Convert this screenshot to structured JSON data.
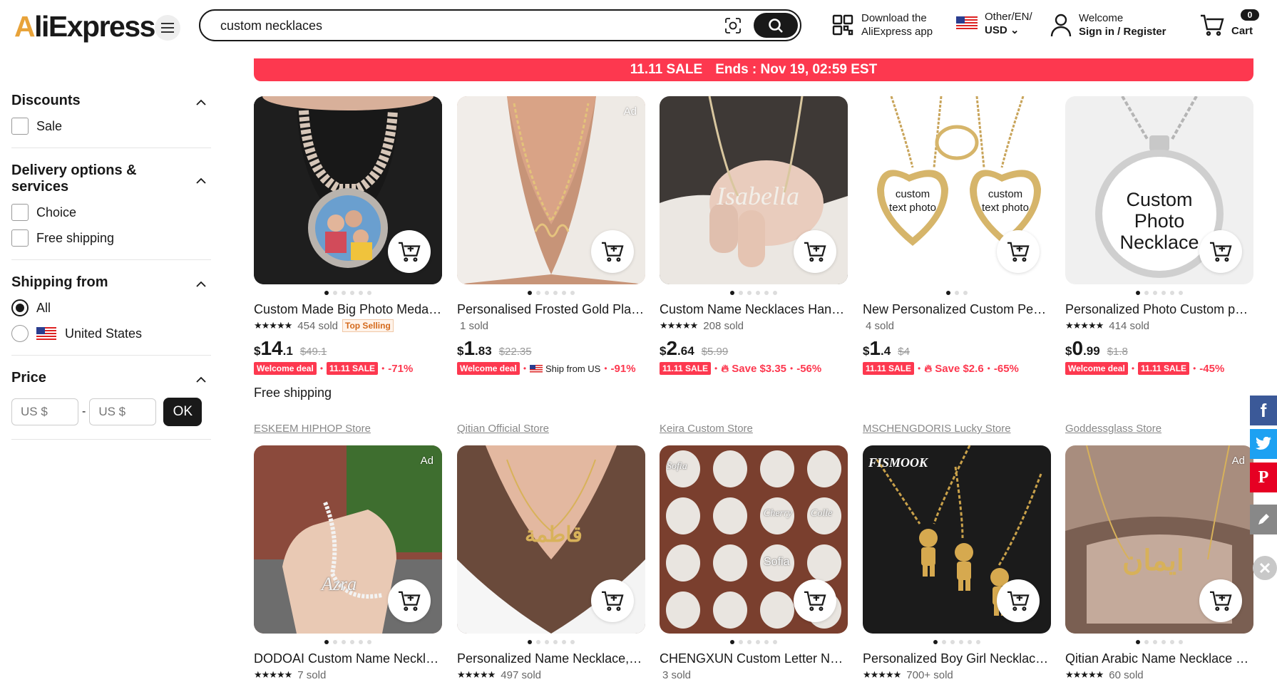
{
  "header": {
    "logo_text": "AliExpress",
    "search_value": "custom necklaces",
    "app_line1": "Download the",
    "app_line2": "AliExpress app",
    "region_line1": "Other/EN/",
    "region_line2": "USD",
    "account_line1": "Welcome",
    "account_line2": "Sign in / Register",
    "cart_count": "0",
    "cart_label": "Cart"
  },
  "banner": {
    "sale": "11.11 SALE",
    "ends": "Ends :  Nov 19, 02:59 EST"
  },
  "sidebar": {
    "discounts": {
      "title": "Discounts",
      "options": [
        "Sale"
      ]
    },
    "delivery": {
      "title": "Delivery options & services",
      "options": [
        "Choice",
        "Free shipping"
      ]
    },
    "shipping": {
      "title": "Shipping from",
      "options": [
        "All",
        "United States"
      ]
    },
    "price": {
      "title": "Price",
      "min_placeholder": "US $",
      "max_placeholder": "US $",
      "dash": "-",
      "ok": "OK"
    }
  },
  "products": [
    {
      "title": "Custom Made Big Photo Medallions Necklace",
      "sold": "454 sold",
      "top_selling": "Top Selling",
      "cur": "$",
      "int": "14",
      "dec": ".1",
      "old": "$49.1",
      "tag1": "Welcome deal",
      "tag2": "11.11 SALE",
      "discount": "-71%",
      "free": "Free shipping",
      "store": "ESKEEM HIPHOP Store",
      "ad": ""
    },
    {
      "title": "Personalised Frosted Gold Plated Name Necklace",
      "sold": "1 sold",
      "cur": "$",
      "int": "1",
      "dec": ".83",
      "old": "$22.35",
      "tag1": "Welcome deal",
      "ship": "Ship from US",
      "discount": "-91%",
      "store": "Qitian Official Store",
      "ad": "Ad"
    },
    {
      "title": "Custom Name Necklaces Handmade",
      "sold": "208 sold",
      "cur": "$",
      "int": "2",
      "dec": ".64",
      "old": "$5.99",
      "tag1": "11.11 SALE",
      "save": "Save $3.35",
      "discount": "-56%",
      "store": "Keira Custom Store",
      "ad": ""
    },
    {
      "title": "New Personalized Custom Pendant",
      "sold": "4 sold",
      "cur": "$",
      "int": "1",
      "dec": ".4",
      "old": "$4",
      "tag1": "11.11 SALE",
      "save": "Save $2.6",
      "discount": "-65%",
      "store": "MSCHENGDORIS Lucky Store",
      "ad": "",
      "photo_text1": "custom text photo",
      "photo_text2": "custom text photo"
    },
    {
      "title": "Personalized Photo Custom pendant",
      "sold": "414 sold",
      "cur": "$",
      "int": "0",
      "dec": ".99",
      "old": "$1.8",
      "tag1": "Welcome deal",
      "tag2": "11.11 SALE",
      "discount": "-45%",
      "store": "Goddessglass Store",
      "ad": "",
      "photo_text1": "Custom Photo Necklace"
    },
    {
      "title": "DODOAI Custom Name Necklace",
      "sold": "7 sold",
      "ad": "Ad",
      "caption": "Azra"
    },
    {
      "title": "Personalized Name Necklace, Initial",
      "sold": "497 sold",
      "ad": ""
    },
    {
      "title": "CHENGXUN Custom Letter Name Necklace",
      "sold": "3 sold",
      "ad": "",
      "tiles": [
        "Sofia",
        "Cherry",
        "Colle",
        "Sofia"
      ]
    },
    {
      "title": "Personalized Boy Girl Necklace Custom",
      "sold": "700+ sold",
      "ad": "",
      "brand": "FISMOOK"
    },
    {
      "title": "Qitian Arabic Name Necklace Personalized",
      "sold": "60 sold",
      "ad": "Ad"
    }
  ],
  "colors": {
    "sale_red": "#fd384f",
    "brand_orange": "#e8a33a",
    "dark": "#191919"
  }
}
